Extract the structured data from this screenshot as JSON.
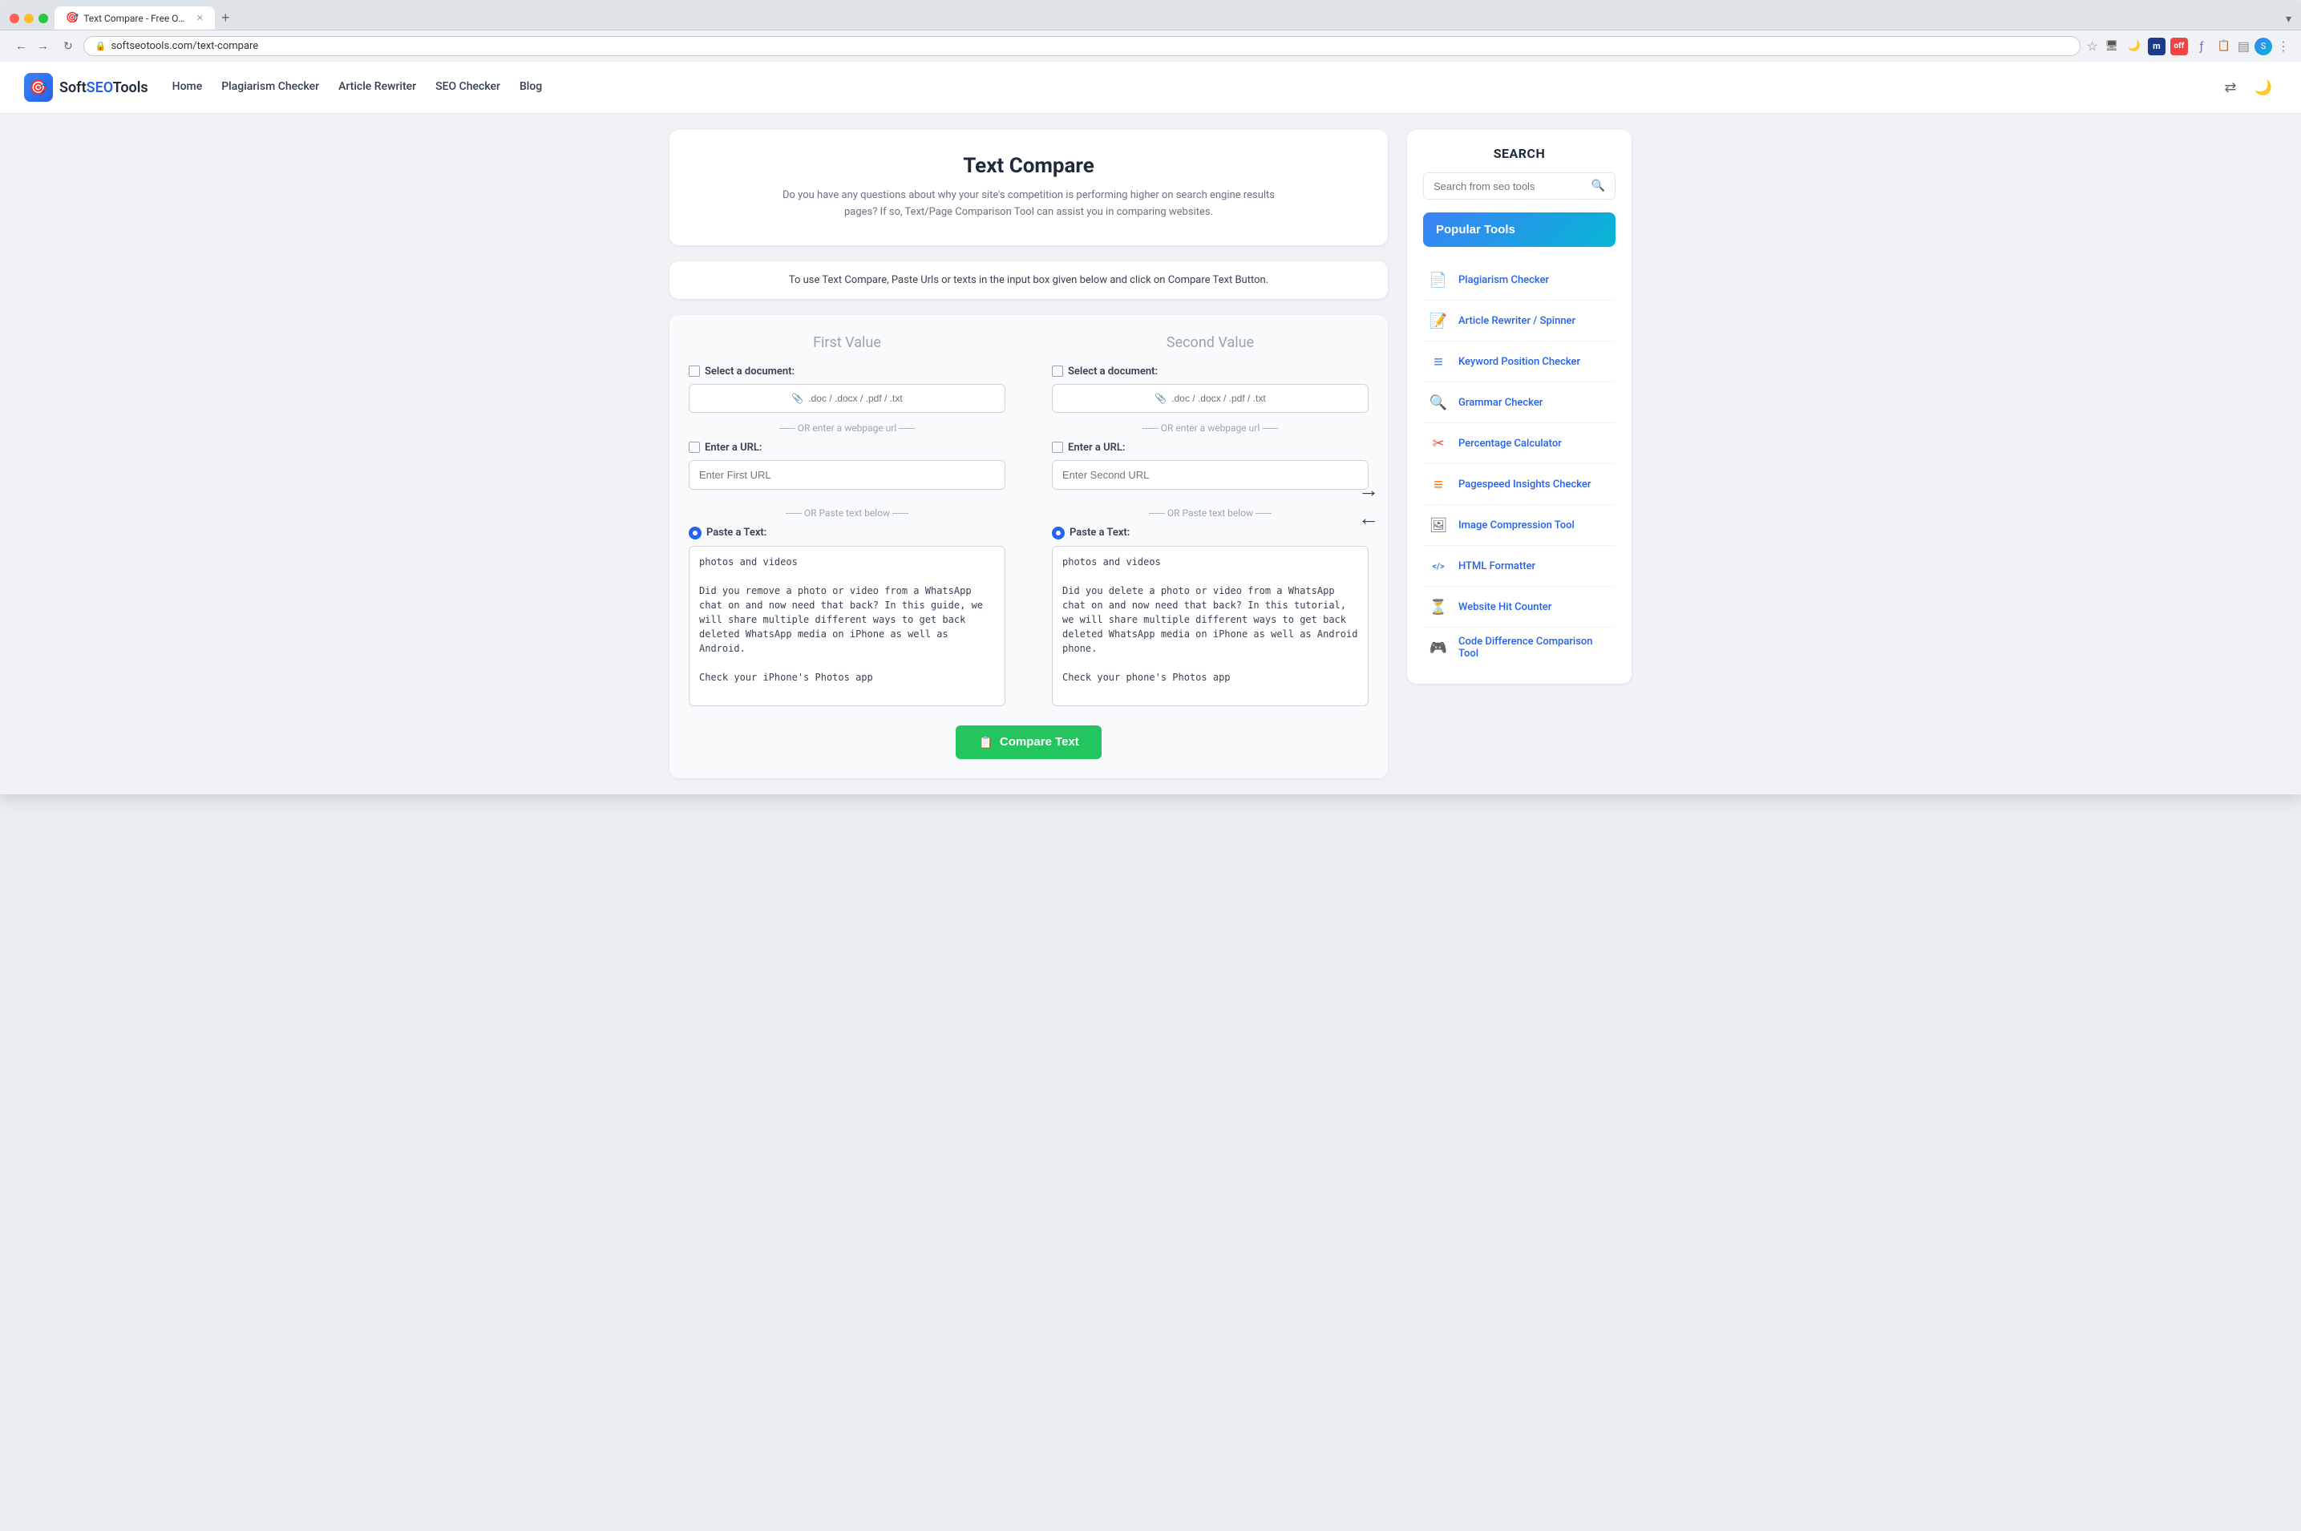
{
  "browser": {
    "tab_title": "Text Compare - Free Online T...",
    "tab_favicon": "🎯",
    "url": "softseotools.com/text-compare",
    "new_tab_label": "+",
    "nav_back": "←",
    "nav_forward": "→",
    "nav_refresh": "↻"
  },
  "header": {
    "logo_icon": "🎯",
    "logo_text_soft": "Soft",
    "logo_text_seo": "SEO",
    "logo_text_tools": "Tools",
    "nav_items": [
      {
        "label": "Home",
        "href": "#"
      },
      {
        "label": "Plagiarism Checker",
        "href": "#"
      },
      {
        "label": "Article Rewriter",
        "href": "#"
      },
      {
        "label": "SEO Checker",
        "href": "#"
      },
      {
        "label": "Blog",
        "href": "#"
      }
    ],
    "dark_mode_icon": "🌙",
    "rtl_icon": "⇄"
  },
  "tool": {
    "title": "Text Compare",
    "description": "Do you have any questions about why your site's competition is performing higher on search engine results pages? If so, Text/Page Comparison Tool can assist you in comparing websites.",
    "instruction": "To use Text Compare, Paste Urls or texts in the input box given below and click on Compare Text Button."
  },
  "compare": {
    "first_col_title": "First Value",
    "second_col_title": "Second Value",
    "select_doc_label": "Select a document:",
    "file_formats": ".doc / .docx / .pdf / .txt",
    "or_url": "------ OR enter a webpage url ------",
    "enter_url_label": "Enter a URL:",
    "first_url_placeholder": "Enter First URL",
    "second_url_placeholder": "Enter Second URL",
    "or_paste": "------ OR Paste text below ------",
    "paste_label": "Paste a Text:",
    "first_textarea_content": "photos and videos\n\nDid you remove a photo or video from a WhatsApp chat on and now need that back? In this guide, we will share multiple different ways to get back deleted WhatsApp media on iPhone as well as Android.\n\nCheck your iPhone's Photos app",
    "second_textarea_content": "photos and videos\n\nDid you delete a photo or video from a WhatsApp chat on and now need that back? In this tutorial, we will share multiple different ways to get back deleted WhatsApp media on iPhone as well as Android phone.\n\nCheck your phone's Photos app",
    "compare_btn_label": "Compare Text",
    "compare_btn_icon": "📋",
    "swap_right_arrow": "→",
    "swap_left_arrow": "←"
  },
  "sidebar": {
    "search_section_title": "SEARCH",
    "search_placeholder": "Search from seo tools",
    "popular_tools_label": "Popular Tools",
    "tools": [
      {
        "name": "Plagiarism Checker",
        "icon": "📄",
        "icon_color": "icon-red",
        "href": "#"
      },
      {
        "name": "Article Rewriter / Spinner",
        "icon": "📝",
        "icon_color": "icon-green",
        "href": "#"
      },
      {
        "name": "Keyword Position Checker",
        "icon": "≡",
        "icon_color": "icon-blue",
        "href": "#"
      },
      {
        "name": "Grammar Checker",
        "icon": "🔍",
        "icon_color": "icon-blue",
        "href": "#"
      },
      {
        "name": "Percentage Calculator",
        "icon": "✂",
        "icon_color": "icon-red",
        "href": "#"
      },
      {
        "name": "Pagespeed Insights Checker",
        "icon": "≡",
        "icon_color": "icon-orange",
        "href": "#"
      },
      {
        "name": "Image Compression Tool",
        "icon": "🖼",
        "icon_color": "icon-gray",
        "href": "#"
      },
      {
        "name": "HTML Formatter",
        "icon": "</>",
        "icon_color": "icon-blue",
        "href": "#"
      },
      {
        "name": "Website Hit Counter",
        "icon": "⏳",
        "icon_color": "icon-yellow",
        "href": "#"
      },
      {
        "name": "Code Difference Comparison Tool",
        "icon": "🎮",
        "icon_color": "icon-red",
        "href": "#"
      }
    ]
  },
  "traffic_lights": {
    "close_color": "#ff5f57",
    "minimize_color": "#ffbd2e",
    "maximize_color": "#28c840"
  }
}
